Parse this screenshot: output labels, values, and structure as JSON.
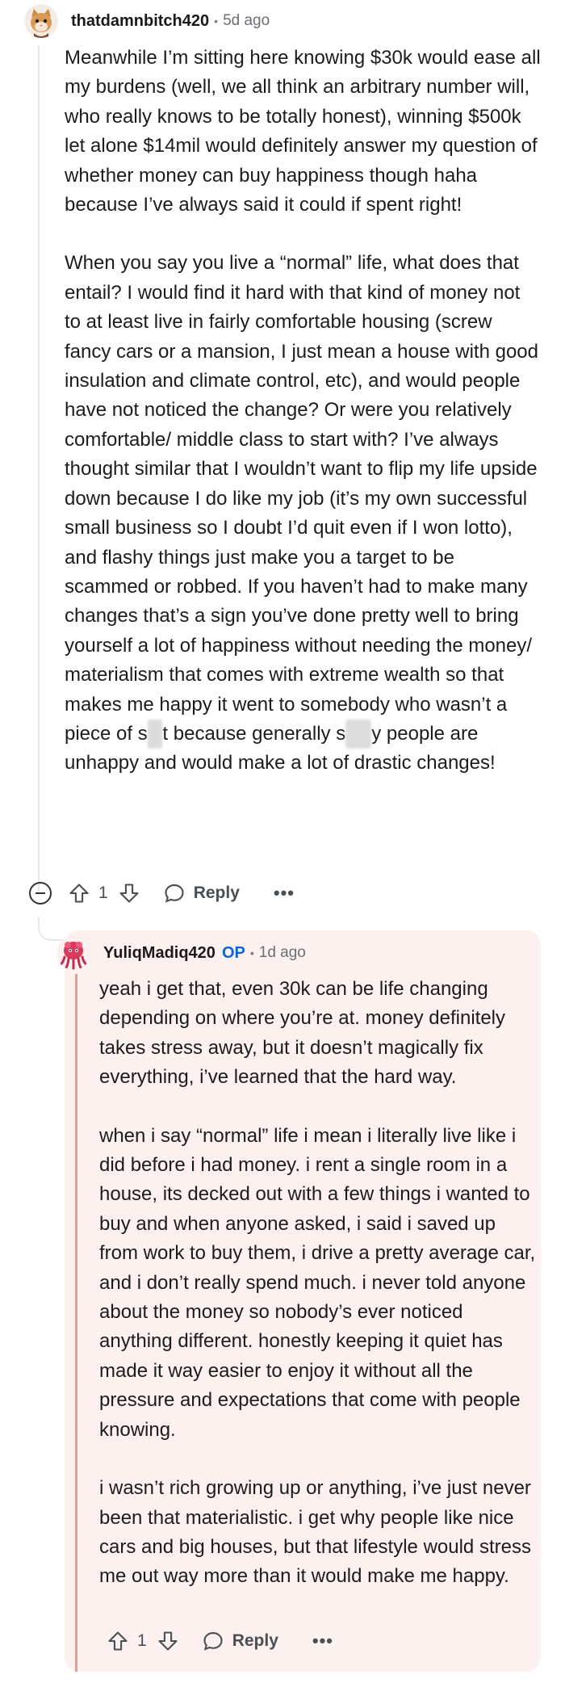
{
  "comment": {
    "username": "thatdamnbitch420",
    "separator": "•",
    "time": "5d ago",
    "paragraphs": [
      "Meanwhile I’m sitting here knowing $30k would ease all my burdens (well, we all think an arbitrary number will, who really knows to be totally honest), winning $500k let alone $14mil would definitely answer my question of whether money can buy happiness though haha because I’ve always said it could if spent right!"
    ],
    "p2": {
      "part1": "When you say you live a “normal” life, what does that entail? I would find it hard with that kind of money not to at least live in fairly comfortable housing (screw fancy cars or a mansion, I just mean a house with good insulation and climate control, etc), and would people have not noticed the change? Or were you relatively comfortable/ middle class to start with? I’ve always thought similar that I wouldn’t want to flip my life upside down because I do like my job (it’s my own successful small business so I doubt I’d quit even if I won lotto), and flashy things just make you a target to be scammed or robbed. If you haven’t had to make many changes that’s a sign you’ve done pretty well to bring yourself a lot of happiness without needing the money/ materialism that comes with extreme wealth so that makes me happy it went to somebody who wasn’t a piece of s",
      "censor1": "hi",
      "part2": "t because generally s",
      "censor2": "hitt",
      "part3": "y people are unhappy and would make a lot of drastic changes!"
    },
    "votes": "1",
    "reply_label": "Reply",
    "more_label": "•••"
  },
  "op_reply": {
    "username": "YuliqMadiq420",
    "op_badge": "OP",
    "separator": "•",
    "time": "1d ago",
    "paragraphs": [
      "yeah i get that, even 30k can be life changing depending on where you’re at. money definitely takes stress away, but it doesn’t magically fix everything, i’ve learned that the hard way.",
      "when i say “normal” life i mean i literally live like i did before i had money. i rent a single room in a house, its decked out with a few things i wanted to buy and when anyone asked, i said i saved up from work to buy them, i drive a pretty average car, and i don’t really spend much. i never told anyone about the money so nobody’s ever noticed anything different. honestly keeping it quiet has made it way easier to enjoy it without all the pressure and expectations that come with people knowing.",
      "i wasn’t rich growing up or anything, i’ve just never been that materialistic. i get why people like nice cars and big houses, but that lifestyle would stress me out way more than it would make me happy."
    ],
    "votes": "1",
    "reply_label": "Reply",
    "more_label": "•••"
  },
  "colors": {
    "op_badge": "#0a66d6",
    "op_card_bg": "#fdf1ef",
    "op_accent": "#e99b91"
  }
}
